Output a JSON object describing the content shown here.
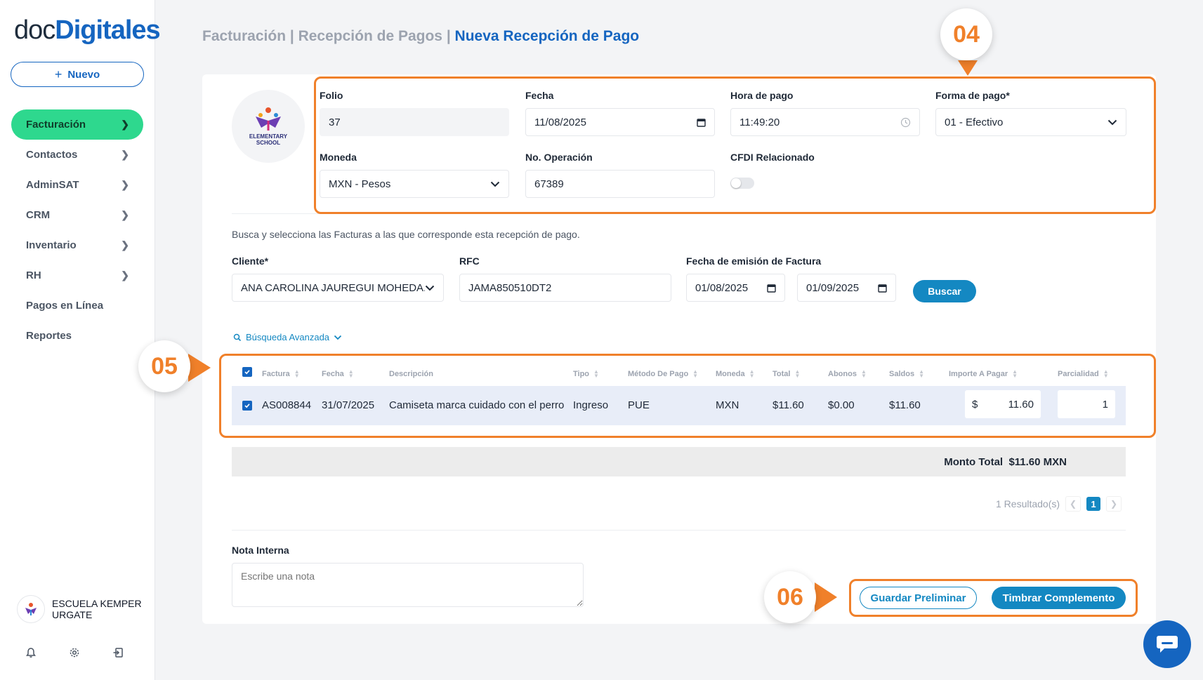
{
  "app": {
    "logo_part1": "doc",
    "logo_part2": "Digitales"
  },
  "sidebar": {
    "new_button": "Nuevo",
    "items": [
      {
        "label": "Facturación",
        "active": true,
        "has_chevron": true
      },
      {
        "label": "Contactos",
        "has_chevron": true
      },
      {
        "label": "AdminSAT",
        "has_chevron": true
      },
      {
        "label": "CRM",
        "has_chevron": true
      },
      {
        "label": "Inventario",
        "has_chevron": true
      },
      {
        "label": "RH",
        "has_chevron": true
      },
      {
        "label": "Pagos en Línea",
        "has_chevron": false
      },
      {
        "label": "Reportes",
        "has_chevron": false
      }
    ],
    "user_name": "ESCUELA KEMPER URGATE",
    "bottom_icons": [
      "bell-icon",
      "gear-icon",
      "logout-icon"
    ]
  },
  "breadcrumb": {
    "part1": "Facturación",
    "sep": " | ",
    "part2": "Recepción de Pagos",
    "current": "Nueva Recepción de Pago"
  },
  "school_logo": {
    "line1": "ELEMENTARY",
    "line2": "SCHOOL"
  },
  "form": {
    "folio_label": "Folio",
    "folio_value": "37",
    "fecha_label": "Fecha",
    "fecha_value": "11/08/2025",
    "hora_label": "Hora de pago",
    "hora_value": "11:49:20",
    "forma_label": "Forma de pago*",
    "forma_value": "01 - Efectivo",
    "moneda_label": "Moneda",
    "moneda_value": "MXN - Pesos",
    "operacion_label": "No. Operación",
    "operacion_value": "67389",
    "cfdi_label": "CFDI Relacionado",
    "cfdi_enabled": false
  },
  "search": {
    "hint": "Busca y selecciona las Facturas a las que corresponde esta recepción de pago.",
    "cliente_label": "Cliente*",
    "cliente_value": "ANA CAROLINA JAUREGUI MOHEDA...",
    "rfc_label": "RFC",
    "rfc_value": "JAMA850510DT2",
    "fecha_emision_label": "Fecha de emisión de Factura",
    "fecha_desde": "01/08/2025",
    "fecha_hasta": "01/09/2025",
    "buscar_button": "Buscar",
    "advanced_label": "Búsqueda Avanzada"
  },
  "table": {
    "headers": [
      "Factura",
      "Fecha",
      "Descripción",
      "Tipo",
      "Método De Pago",
      "Moneda",
      "Total",
      "Abonos",
      "Saldos",
      "Importe A Pagar",
      "Parcialidad"
    ],
    "rows": [
      {
        "selected": true,
        "factura": "AS008844",
        "fecha": "31/07/2025",
        "descripcion": "Camiseta marca cuidado con el perro",
        "tipo": "Ingreso",
        "metodo": "PUE",
        "moneda": "MXN",
        "total": "$11.60",
        "abonos": "$0.00",
        "saldos": "$11.60",
        "importe_currency": "$",
        "importe": "11.60",
        "parcialidad": "1"
      }
    ]
  },
  "total": {
    "label": "Monto Total",
    "value": "$11.60 MXN"
  },
  "pagination": {
    "results": "1 Resultado(s)",
    "current_page": "1"
  },
  "nota": {
    "label": "Nota Interna",
    "placeholder": "Escribe una nota"
  },
  "actions": {
    "preliminar": "Guardar Preliminar",
    "timbrar": "Timbrar Complemento"
  },
  "annotations": {
    "a04": "04",
    "a05": "05",
    "a06": "06"
  },
  "colors": {
    "accent": "#1488c2",
    "brand": "#1565c0",
    "active_nav": "#2ed88e",
    "annotation": "#f0802a"
  }
}
